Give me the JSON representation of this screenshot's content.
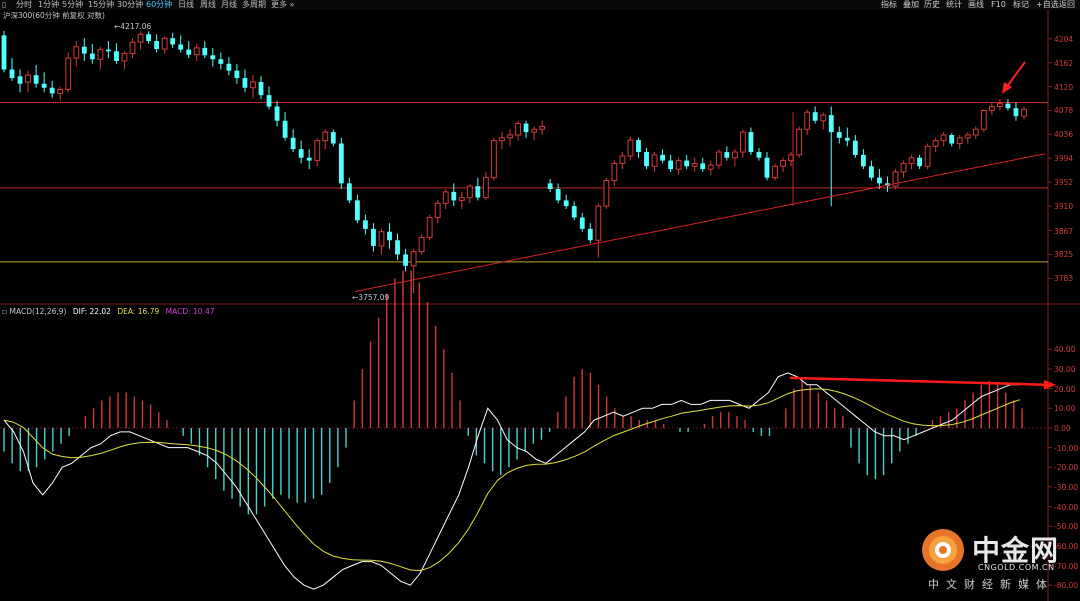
{
  "toolbar": {
    "periods": [
      "分时",
      "1分钟",
      "5分钟",
      "15分钟",
      "30分钟",
      "60分钟",
      "日线",
      "周线",
      "月线",
      "多周期",
      "更多"
    ],
    "active_period": "60分钟",
    "right_items": [
      "指标",
      "叠加",
      "历史",
      "统计",
      "画线",
      "F10",
      "标记",
      "+自选",
      "返回"
    ]
  },
  "header": {
    "instrument": "沪深300(60分钟 前复权 对数)",
    "macd_label": "MACD(12,26,9)",
    "dif_label": "DIF: 22.02",
    "dea_label": "DEA: 16.79",
    "macd_value_label": "MACD: 10.47"
  },
  "annotations": {
    "high": "4217.06",
    "low": "3757.09"
  },
  "colors": {
    "up": "#d23a3a",
    "down": "#54ffff",
    "dif": "#ffffff",
    "dea": "#e0e040",
    "axis": "#d23a3a"
  },
  "chart_data": [
    {
      "type": "candlestick",
      "title": "沪深300(60分钟 前复权 对数)",
      "y_ticks": [
        3783,
        3825,
        3867,
        3910,
        3952,
        3994,
        4036,
        4078,
        4120,
        4162,
        4204
      ],
      "ylim": [
        3745,
        4237
      ],
      "high_label": 4217.06,
      "low_label": 3757.09,
      "ohlc": [
        [
          4210,
          4218,
          4145,
          4150
        ],
        [
          4150,
          4170,
          4130,
          4135
        ],
        [
          4138,
          4150,
          4110,
          4125
        ],
        [
          4128,
          4148,
          4110,
          4140
        ],
        [
          4140,
          4158,
          4118,
          4125
        ],
        [
          4125,
          4145,
          4110,
          4118
        ],
        [
          4118,
          4130,
          4100,
          4108
        ],
        [
          4108,
          4120,
          4095,
          4115
        ],
        [
          4115,
          4180,
          4110,
          4170
        ],
        [
          4170,
          4200,
          4155,
          4190
        ],
        [
          4190,
          4205,
          4165,
          4178
        ],
        [
          4178,
          4195,
          4160,
          4168
        ],
        [
          4168,
          4190,
          4150,
          4185
        ],
        [
          4185,
          4200,
          4170,
          4182
        ],
        [
          4182,
          4196,
          4160,
          4165
        ],
        [
          4165,
          4182,
          4150,
          4178
        ],
        [
          4178,
          4205,
          4170,
          4198
        ],
        [
          4198,
          4217,
          4185,
          4212
        ],
        [
          4212,
          4217,
          4195,
          4200
        ],
        [
          4200,
          4212,
          4180,
          4186
        ],
        [
          4186,
          4208,
          4178,
          4205
        ],
        [
          4205,
          4215,
          4188,
          4194
        ],
        [
          4194,
          4210,
          4180,
          4185
        ],
        [
          4185,
          4200,
          4170,
          4176
        ],
        [
          4176,
          4195,
          4165,
          4188
        ],
        [
          4188,
          4200,
          4170,
          4175
        ],
        [
          4175,
          4188,
          4155,
          4168
        ],
        [
          4168,
          4180,
          4150,
          4160
        ],
        [
          4160,
          4172,
          4140,
          4148
        ],
        [
          4148,
          4160,
          4125,
          4135
        ],
        [
          4135,
          4150,
          4110,
          4118
        ],
        [
          4118,
          4140,
          4100,
          4128
        ],
        [
          4128,
          4138,
          4098,
          4105
        ],
        [
          4105,
          4120,
          4080,
          4085
        ],
        [
          4085,
          4095,
          4050,
          4060
        ],
        [
          4060,
          4075,
          4025,
          4030
        ],
        [
          4030,
          4045,
          4005,
          4010
        ],
        [
          4010,
          4025,
          3985,
          3995
        ],
        [
          3995,
          4010,
          3975,
          3990
        ],
        [
          3990,
          4030,
          3980,
          4025
        ],
        [
          4025,
          4045,
          4010,
          4040
        ],
        [
          4040,
          4045,
          4015,
          4020
        ],
        [
          4020,
          4030,
          3940,
          3950
        ],
        [
          3950,
          3960,
          3915,
          3920
        ],
        [
          3920,
          3930,
          3880,
          3885
        ],
        [
          3885,
          3895,
          3860,
          3870
        ],
        [
          3870,
          3880,
          3830,
          3840
        ],
        [
          3840,
          3870,
          3825,
          3865
        ],
        [
          3865,
          3880,
          3835,
          3850
        ],
        [
          3850,
          3862,
          3815,
          3825
        ],
        [
          3825,
          3835,
          3795,
          3805
        ],
        [
          3805,
          3835,
          3757,
          3830
        ],
        [
          3830,
          3860,
          3825,
          3855
        ],
        [
          3855,
          3895,
          3850,
          3890
        ],
        [
          3890,
          3920,
          3880,
          3915
        ],
        [
          3915,
          3940,
          3905,
          3935
        ],
        [
          3935,
          3950,
          3910,
          3920
        ],
        [
          3920,
          3935,
          3905,
          3925
        ],
        [
          3925,
          3948,
          3915,
          3945
        ],
        [
          3945,
          3960,
          3920,
          3925
        ],
        [
          3925,
          3970,
          3920,
          3960
        ],
        [
          3960,
          4030,
          3955,
          4025
        ],
        [
          4025,
          4040,
          4010,
          4030
        ],
        [
          4030,
          4045,
          4015,
          4035
        ],
        [
          4035,
          4060,
          4025,
          4055
        ],
        [
          4055,
          4060,
          4030,
          4040
        ],
        [
          4040,
          4050,
          4025,
          4045
        ],
        [
          4045,
          4060,
          4035,
          4050
        ],
        [
          3950,
          3958,
          3935,
          3940
        ],
        [
          3940,
          3950,
          3915,
          3920
        ],
        [
          3920,
          3930,
          3905,
          3910
        ],
        [
          3910,
          3918,
          3885,
          3890
        ],
        [
          3890,
          3898,
          3865,
          3870
        ],
        [
          3870,
          3880,
          3845,
          3850
        ],
        [
          3850,
          3915,
          3820,
          3910
        ],
        [
          3910,
          3960,
          3905,
          3955
        ],
        [
          3955,
          3990,
          3945,
          3985
        ],
        [
          3985,
          4005,
          3975,
          3998
        ],
        [
          3998,
          4032,
          3990,
          4026
        ],
        [
          4026,
          4030,
          3995,
          4005
        ],
        [
          4005,
          4012,
          3975,
          3980
        ],
        [
          3980,
          4005,
          3970,
          4000
        ],
        [
          4000,
          4010,
          3985,
          3990
        ],
        [
          3990,
          4000,
          3970,
          3975
        ],
        [
          3975,
          3995,
          3965,
          3990
        ],
        [
          3990,
          4000,
          3975,
          3980
        ],
        [
          3980,
          3995,
          3970,
          3985
        ],
        [
          3985,
          3995,
          3970,
          3975
        ],
        [
          3975,
          3990,
          3965,
          3982
        ],
        [
          3982,
          4010,
          3975,
          4005
        ],
        [
          4005,
          4015,
          3990,
          3995
        ],
        [
          3995,
          4010,
          3980,
          4005
        ],
        [
          4005,
          4045,
          3995,
          4040
        ],
        [
          4040,
          4048,
          4000,
          4005
        ],
        [
          4005,
          4012,
          3990,
          3995
        ],
        [
          3995,
          4005,
          3955,
          3960
        ],
        [
          3960,
          3985,
          3955,
          3980
        ],
        [
          3980,
          3995,
          3970,
          3990
        ],
        [
          3990,
          4005,
          3980,
          4000
        ],
        [
          4000,
          4050,
          3995,
          4045
        ],
        [
          4045,
          4080,
          4035,
          4075
        ],
        [
          4075,
          4085,
          4055,
          4060
        ],
        [
          4060,
          4075,
          4045,
          4070
        ],
        [
          4070,
          4085,
          3910,
          4040
        ],
        [
          4040,
          4050,
          4020,
          4030
        ],
        [
          4030,
          4048,
          4015,
          4025
        ],
        [
          4025,
          4035,
          3995,
          4000
        ],
        [
          4000,
          4010,
          3975,
          3980
        ],
        [
          3980,
          3990,
          3955,
          3960
        ],
        [
          3960,
          3975,
          3940,
          3950
        ],
        [
          3950,
          3962,
          3935,
          3945
        ],
        [
          3945,
          3975,
          3940,
          3970
        ],
        [
          3970,
          3990,
          3960,
          3985
        ],
        [
          3985,
          4000,
          3975,
          3995
        ],
        [
          3995,
          4000,
          3975,
          3980
        ],
        [
          3980,
          4020,
          3975,
          4015
        ],
        [
          4015,
          4030,
          4005,
          4025
        ],
        [
          4025,
          4040,
          4015,
          4035
        ],
        [
          4035,
          4038,
          4015,
          4020
        ],
        [
          4020,
          4035,
          4010,
          4030
        ],
        [
          4030,
          4040,
          4020,
          4035
        ],
        [
          4035,
          4050,
          4028,
          4045
        ],
        [
          4045,
          4080,
          4040,
          4078
        ],
        [
          4078,
          4092,
          4070,
          4085
        ],
        [
          4085,
          4098,
          4078,
          4090
        ],
        [
          4090,
          4098,
          4078,
          4082
        ],
        [
          4082,
          4092,
          4060,
          4068
        ],
        [
          4068,
          4085,
          4062,
          4080
        ]
      ]
    },
    {
      "type": "macd",
      "title": "MACD(12,26,9)",
      "y_ticks": [
        -80,
        -70,
        -60,
        -50,
        -40,
        -30,
        -20,
        -10,
        0,
        10,
        20,
        30,
        40
      ],
      "ylim": [
        -86,
        60
      ],
      "legend": [
        "DIF: 22.02",
        "DEA: 16.79",
        "MACD: 10.47"
      ],
      "hist": [
        -12,
        -18,
        -22,
        -22,
        -20,
        -16,
        -12,
        -8,
        -4,
        0,
        6,
        10,
        14,
        16,
        18,
        18,
        16,
        14,
        12,
        8,
        4,
        0,
        -4,
        -8,
        -14,
        -20,
        -26,
        -32,
        -36,
        -40,
        -44,
        -44,
        -40,
        -36,
        -34,
        -36,
        -38,
        -38,
        -36,
        -34,
        -28,
        -20,
        -10,
        14,
        30,
        44,
        56,
        68,
        76,
        80,
        80,
        74,
        64,
        52,
        40,
        28,
        14,
        -4,
        -14,
        -18,
        -22,
        -24,
        -20,
        -16,
        -12,
        -8,
        -6,
        -2,
        8,
        16,
        26,
        30,
        28,
        22,
        16,
        10,
        6,
        6,
        4,
        4,
        4,
        2,
        0,
        -2,
        -2,
        0,
        2,
        6,
        8,
        8,
        6,
        4,
        -2,
        -4,
        -4,
        0,
        10,
        20,
        24,
        22,
        18,
        14,
        10,
        6,
        -10,
        -18,
        -24,
        -26,
        -24,
        -18,
        -12,
        -8,
        -4,
        0,
        4,
        6,
        8,
        10,
        14,
        18,
        22,
        24,
        22,
        18,
        14,
        10
      ]
    }
  ]
}
